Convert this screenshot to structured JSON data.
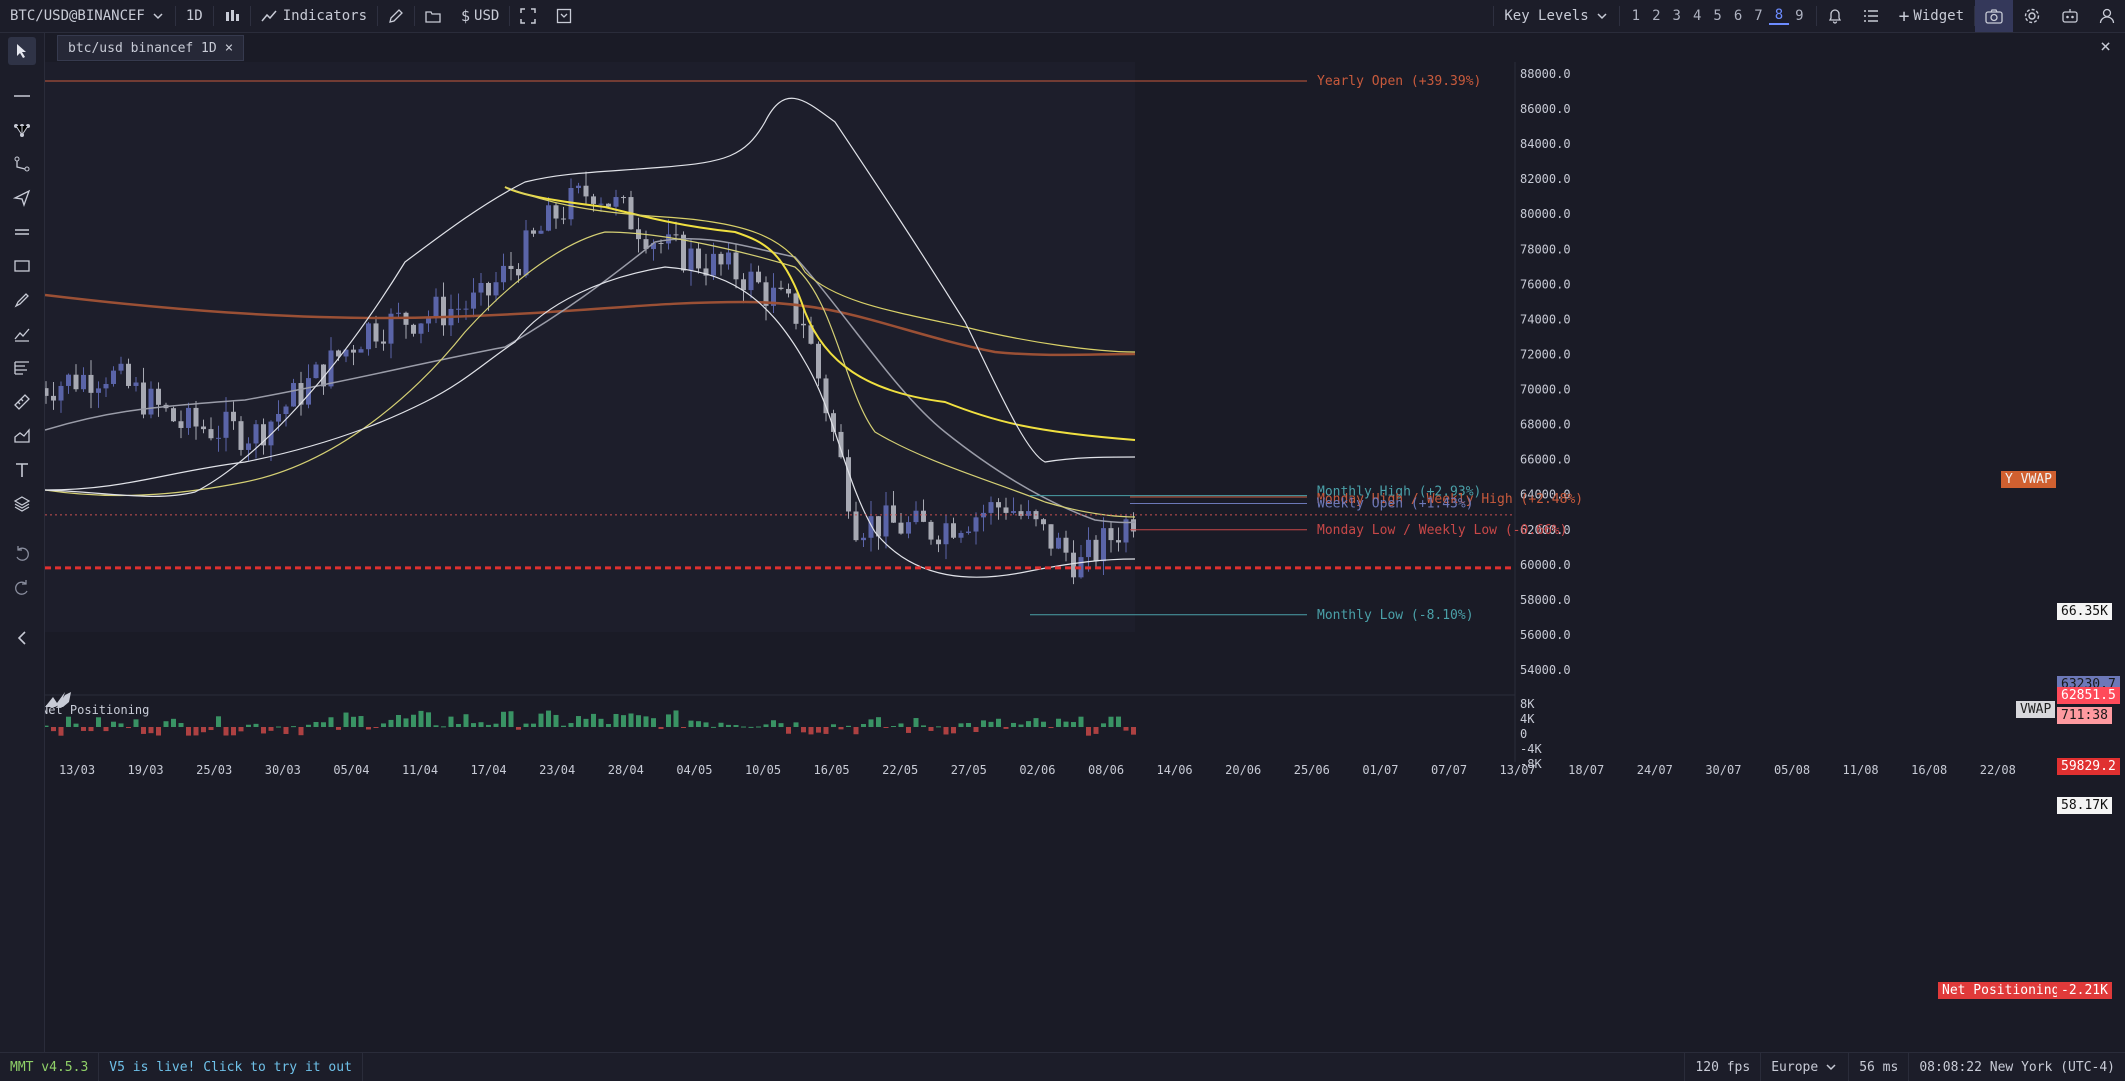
{
  "toolbar": {
    "symbol": "BTC/USD@BINANCEF",
    "interval": "1D",
    "indicators_label": "Indicators",
    "currency_label": "USD",
    "key_levels_label": "Key Levels",
    "layout_numbers": [
      "1",
      "2",
      "3",
      "4",
      "5",
      "6",
      "7",
      "8",
      "9"
    ],
    "active_layout": "8",
    "widget_label": "Widget"
  },
  "tab": {
    "label": "btc/usd binancef 1D"
  },
  "price_axis": [
    "88000.0",
    "86000.0",
    "84000.0",
    "82000.0",
    "80000.0",
    "78000.0",
    "76000.0",
    "74000.0",
    "72000.0",
    "70000.0",
    "68000.0",
    "66000.0",
    "64000.0",
    "62000.0",
    "60000.0",
    "58000.0",
    "56000.0",
    "54000.0"
  ],
  "time_axis": [
    "13/03",
    "19/03",
    "25/03",
    "30/03",
    "05/04",
    "11/04",
    "17/04",
    "23/04",
    "28/04",
    "04/05",
    "10/05",
    "16/05",
    "22/05",
    "27/05",
    "02/06",
    "08/06",
    "14/06",
    "20/06",
    "25/06",
    "01/07",
    "07/07",
    "13/07",
    "18/07",
    "24/07",
    "30/07",
    "05/08",
    "11/08",
    "16/08",
    "22/08"
  ],
  "levels": {
    "yearly_open": "Yearly Open (+39.39%)",
    "monthly_high": "Monthly High (+2.93%)",
    "monday_high": "Monday High / Weekly High (+2.48%)",
    "weekly_open": "Weekly Open (+1.43%)",
    "monday_low": "Monday Low / Weekly Low (-0.66%)",
    "monthly_low": "Monthly Low (-8.10%)"
  },
  "price_tags": {
    "y_vwap": "Y VWAP",
    "vwap": "VWAP",
    "tag_66k": "66.35K",
    "last_price": "62851.5",
    "countdown": "711:38",
    "dashed_level": "59829.2",
    "tag_58k": "58.17K",
    "hidden_tag": "63230.7"
  },
  "net_positioning": {
    "title": "Net Positioning",
    "axis": [
      "8K",
      "4K",
      "0",
      "-4K",
      "-8K"
    ],
    "tag_label": "Net Positioning",
    "tag_value": "-2.21K"
  },
  "status_bar": {
    "version": "MMT v4.5.3",
    "promo": "V5 is live! Click to try it out",
    "fps": "120 fps",
    "region": "Europe",
    "latency": "56 ms",
    "clock": "08:08:22 New York (UTC-4)"
  },
  "colors": {
    "background": "#1a1b26",
    "bull_candle": "#5a64a8",
    "bear_candle": "#a7a9b3",
    "yearly_open_line": "#c85a3c",
    "yvwap_line": "#9b5035",
    "ma_yellow": "#f0e040",
    "dashed_red": "#e03030",
    "monthly_level": "#4aa0a8",
    "np_positive": "#3fa870",
    "np_negative": "#c84848"
  }
}
